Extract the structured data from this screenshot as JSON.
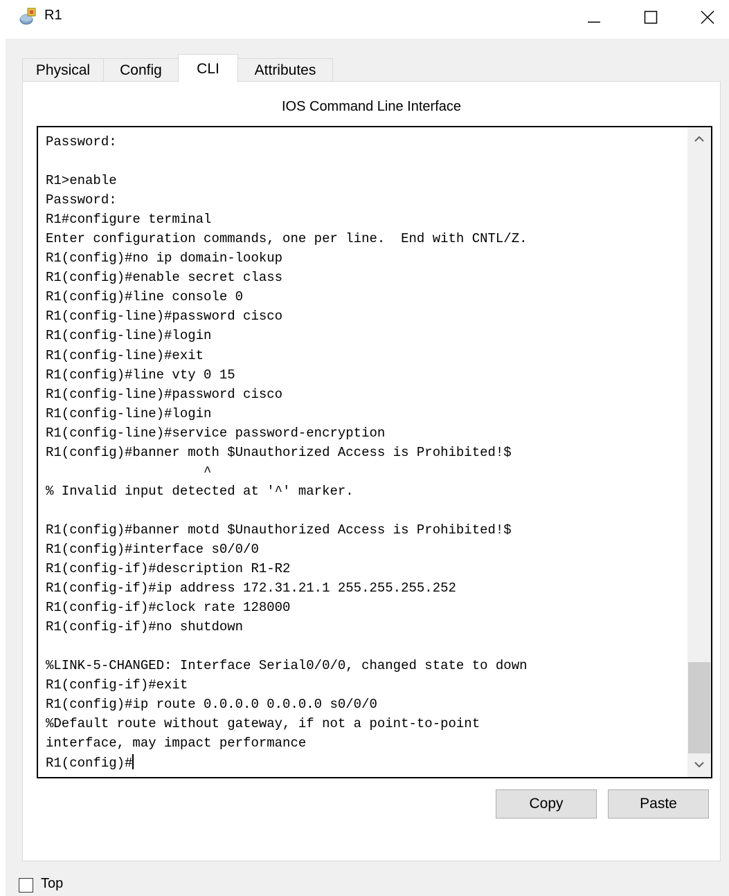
{
  "window": {
    "title": "R1",
    "icon": "router-icon",
    "controls": [
      "minimize-icon",
      "maximize-icon",
      "close-icon"
    ]
  },
  "tabs": [
    {
      "label": "Physical",
      "active": false
    },
    {
      "label": "Config",
      "active": false
    },
    {
      "label": "CLI",
      "active": true
    },
    {
      "label": "Attributes",
      "active": false
    }
  ],
  "panel": {
    "title": "IOS Command Line Interface"
  },
  "terminal": {
    "lines": [
      "Password:",
      "",
      "R1>enable",
      "Password:",
      "R1#configure terminal",
      "Enter configuration commands, one per line.  End with CNTL/Z.",
      "R1(config)#no ip domain-lookup",
      "R1(config)#enable secret class",
      "R1(config)#line console 0",
      "R1(config-line)#password cisco",
      "R1(config-line)#login",
      "R1(config-line)#exit",
      "R1(config)#line vty 0 15",
      "R1(config-line)#password cisco",
      "R1(config-line)#login",
      "R1(config-line)#service password-encryption",
      "R1(config)#banner moth $Unauthorized Access is Prohibited!$",
      "                    ^",
      "% Invalid input detected at '^' marker.",
      "",
      "R1(config)#banner motd $Unauthorized Access is Prohibited!$",
      "R1(config)#interface s0/0/0",
      "R1(config-if)#description R1-R2",
      "R1(config-if)#ip address 172.31.21.1 255.255.255.252",
      "R1(config-if)#clock rate 128000",
      "R1(config-if)#no shutdown",
      "",
      "%LINK-5-CHANGED: Interface Serial0/0/0, changed state to down",
      "R1(config-if)#exit",
      "R1(config)#ip route 0.0.0.0 0.0.0.0 s0/0/0",
      "%Default route without gateway, if not a point-to-point",
      "interface, may impact performance"
    ],
    "prompt": "R1(config)#"
  },
  "buttons": {
    "copy": "Copy",
    "paste": "Paste"
  },
  "footer": {
    "top_label": "Top",
    "top_checked": false
  }
}
